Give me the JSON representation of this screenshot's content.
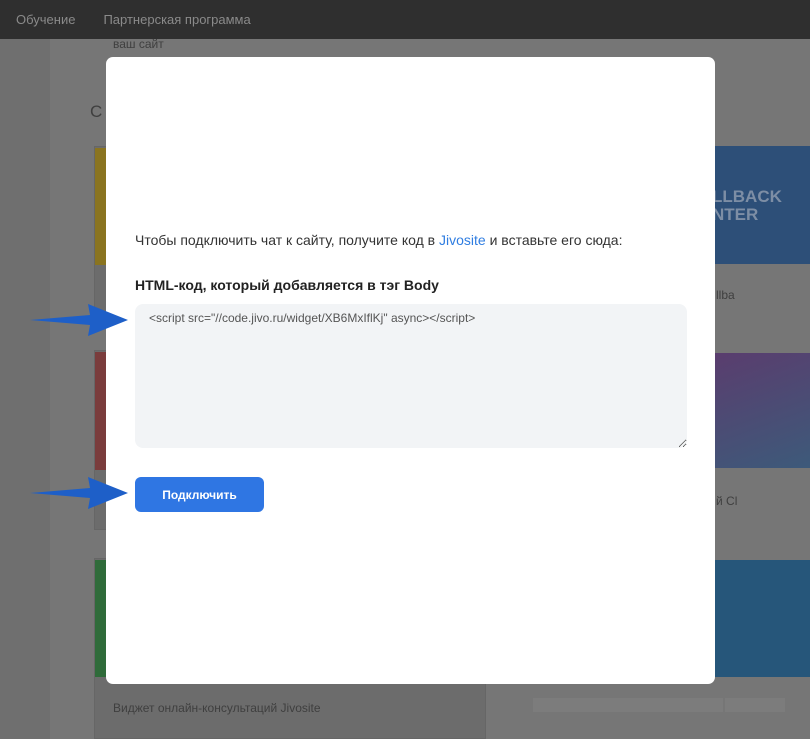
{
  "topbar": {
    "items": [
      "Обучение",
      "Партнерская программа"
    ]
  },
  "background": {
    "site_text": "ваш сайт",
    "section_initial": "С",
    "card_left_3_title": "Виджет онлайн-консультаций Jivosite",
    "card_right_1_logo": "LLBACK NTER",
    "card_right_1_text": "llba",
    "card_right_2_text": "й Cl"
  },
  "modal": {
    "intro_before": "Чтобы подключить чат к сайту, получите код в ",
    "intro_link": "Jivosite",
    "intro_after": " и вставьте его сюда:",
    "field_label": "HTML-код, который добавляется в тэг Body",
    "code_value": "<script src=\"//code.jivo.ru/widget/XB6MxIflKj\" async></script>\n",
    "connect_button": "Подключить"
  },
  "colors": {
    "accent": "#2f76e3",
    "link": "#2f7de1",
    "arrow": "#1e5fc8"
  }
}
